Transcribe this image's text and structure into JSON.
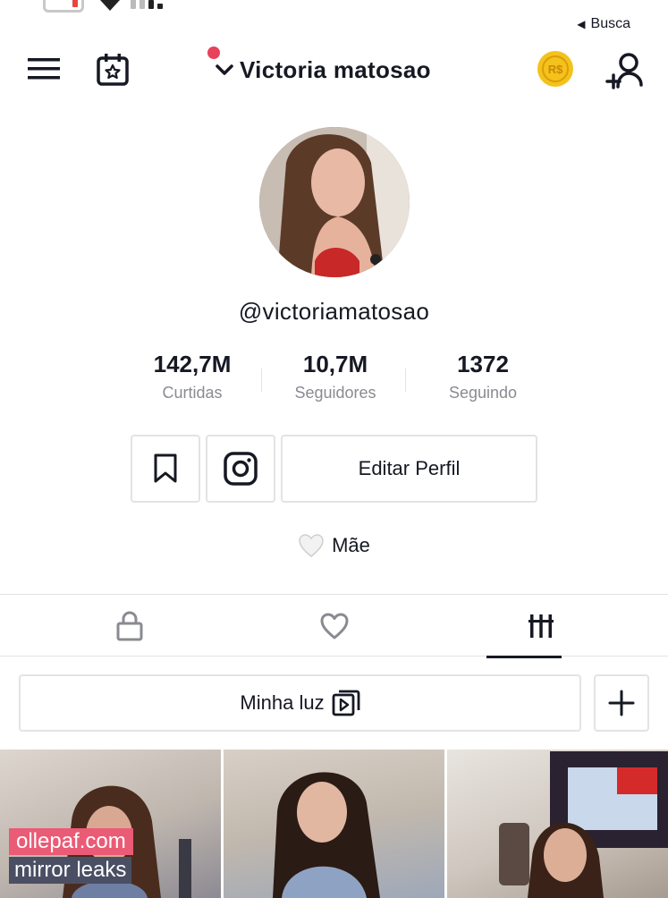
{
  "status_bar": {
    "back_label": "Busca",
    "back_arrow": "◀"
  },
  "header": {
    "title": "Victoria matosao",
    "chevron": "❯",
    "menu_icon": "hamburger-icon",
    "calendar_icon": "calendar-star-icon",
    "coin_icon": "coin-icon",
    "coin_text": "R$",
    "add_user_icon": "add-user-icon",
    "notification_color": "#e8415a"
  },
  "profile": {
    "username": "@victoriamatosao",
    "stats": [
      {
        "value": "1372",
        "label": "Seguindo"
      },
      {
        "value": "10,7M",
        "label": "Seguidores"
      },
      {
        "value": "142,7M",
        "label": "Curtidas"
      }
    ],
    "edit_label": "Editar Perfil",
    "bio_text": "Mãe",
    "bio_emoji": "🤍"
  },
  "tabs": [
    {
      "name": "videos-grid-icon",
      "active": true
    },
    {
      "name": "liked-heart-icon",
      "active": false
    },
    {
      "name": "private-lock-icon",
      "active": false
    }
  ],
  "playlist": {
    "label": "Minha luz",
    "add_symbol": "+"
  },
  "watermark": {
    "line1": "ollepaf.com",
    "line2": "mirror leaks"
  },
  "colors": {
    "accent": "#e8415a",
    "border": "#e3e3e4",
    "muted": "#8a8b91",
    "text": "#161823",
    "coin": "#f4c21b"
  }
}
